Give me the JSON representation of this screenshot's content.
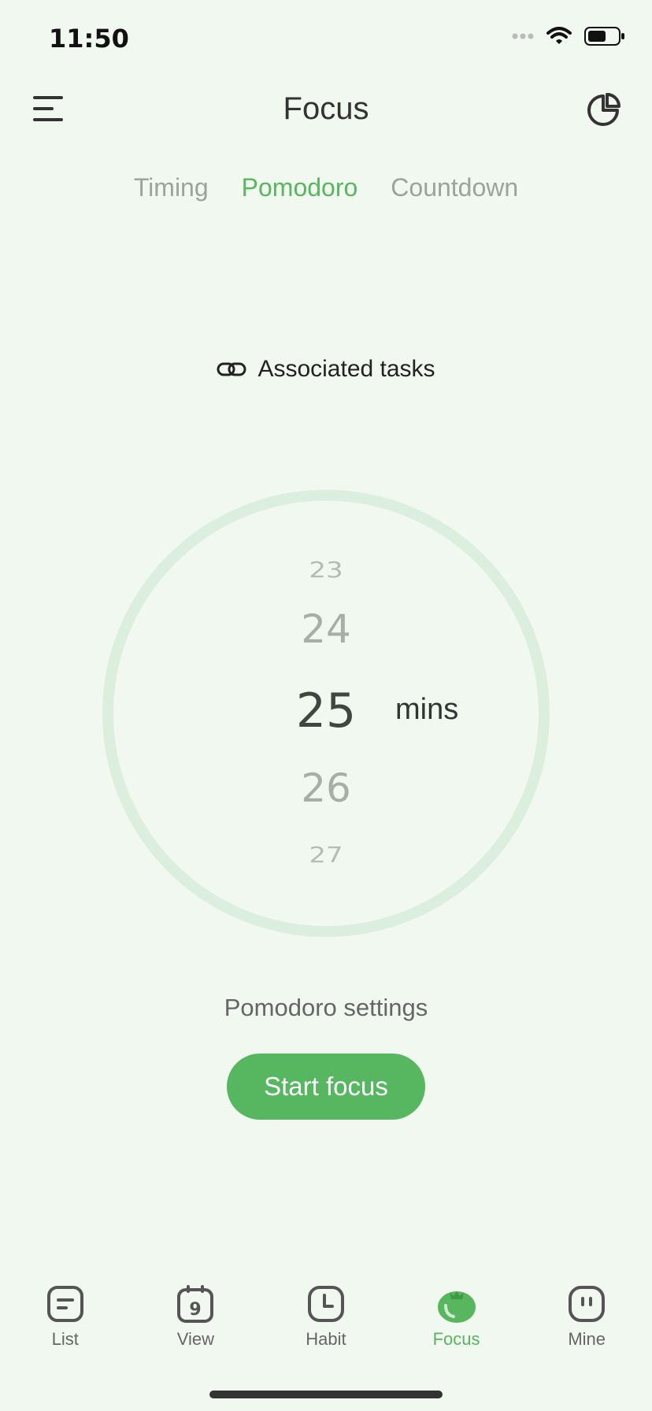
{
  "status": {
    "time": "11:50"
  },
  "header": {
    "title": "Focus"
  },
  "tabs": [
    {
      "label": "Timing",
      "active": false
    },
    {
      "label": "Pomodoro",
      "active": true
    },
    {
      "label": "Countdown",
      "active": false
    }
  ],
  "associated_label": "Associated tasks",
  "picker": {
    "values": [
      "23",
      "24",
      "25",
      "26",
      "27"
    ],
    "selected": "25",
    "unit": "mins"
  },
  "settings_label": "Pomodoro settings",
  "start_label": "Start focus",
  "bottom_nav": [
    {
      "label": "List",
      "icon": "list-icon"
    },
    {
      "label": "View",
      "icon": "calendar-icon",
      "badge": "9"
    },
    {
      "label": "Habit",
      "icon": "clock-icon"
    },
    {
      "label": "Focus",
      "icon": "tomato-icon",
      "active": true
    },
    {
      "label": "Mine",
      "icon": "face-icon"
    }
  ],
  "colors": {
    "accent": "#58B65F",
    "background": "#F1F8EF",
    "ring": "#DCEFDF"
  }
}
